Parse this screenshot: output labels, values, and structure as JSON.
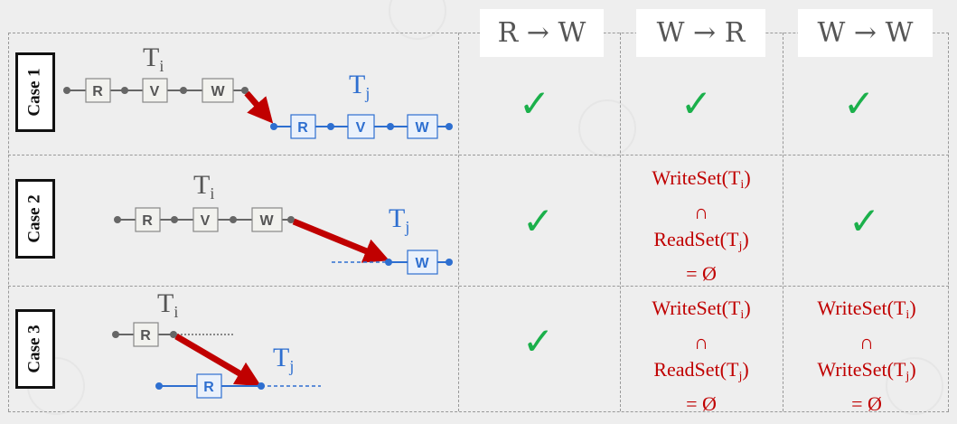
{
  "columns": [
    "R → W",
    "W → R",
    "W → W"
  ],
  "cases": [
    {
      "label": "Case 1",
      "rw": "✓",
      "wr": "✓",
      "ww": "✓"
    },
    {
      "label": "Case 2",
      "rw": "✓",
      "wr": {
        "line1": "WriteSet(T",
        "sub1": "i",
        "line2": "∩",
        "line3": "ReadSet(T",
        "sub3": "j",
        "line4": "= Ø"
      },
      "ww": "✓"
    },
    {
      "label": "Case 3",
      "rw": "✓",
      "wr": {
        "line1": "WriteSet(T",
        "sub1": "i",
        "line2": "∩",
        "line3": "ReadSet(T",
        "sub3": "j",
        "line4": "= Ø"
      },
      "ww": {
        "line1": "WriteSet(T",
        "sub1": "i",
        "line2": "∩",
        "line3": "WriteSet(T",
        "sub3": "j",
        "line4": "= Ø"
      }
    }
  ],
  "phases": {
    "read": "R",
    "validate": "V",
    "write": "W"
  },
  "transactions": {
    "ti": "T",
    "ti_sub": "i",
    "tj": "T",
    "tj_sub": "j"
  },
  "colors": {
    "ti": "#666666",
    "tj": "#2e6fd0",
    "arrow": "#c00000",
    "check": "#1bb04b",
    "condition": "#c00000"
  }
}
